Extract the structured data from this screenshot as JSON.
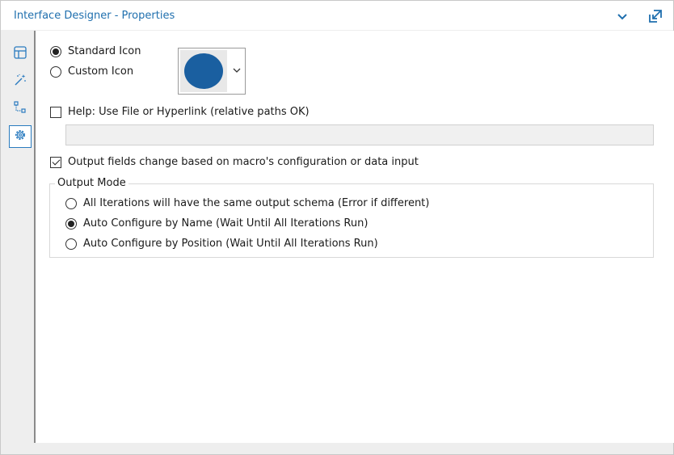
{
  "window": {
    "title": "Interface Designer - Properties"
  },
  "colors": {
    "title": "#1f6fae",
    "accent": "#2a7bbf",
    "icon_fill": "#1a5fa0"
  },
  "sidebar": {
    "tabs": [
      {
        "name": "layout-icon",
        "active": false
      },
      {
        "name": "magic-wand-icon",
        "active": false
      },
      {
        "name": "tree-icon",
        "active": false
      },
      {
        "name": "gear-icon",
        "active": true
      }
    ]
  },
  "icon_options": {
    "standard_label": "Standard Icon",
    "custom_label": "Custom Icon",
    "selected": "standard"
  },
  "help": {
    "label": "Help: Use File or Hyperlink (relative paths OK)",
    "checked": false,
    "value": ""
  },
  "output_fields": {
    "label": "Output fields change based on macro's configuration or data input",
    "checked": true
  },
  "output_mode": {
    "legend": "Output Mode",
    "options": [
      {
        "label": "All Iterations will have the same output schema (Error if different)",
        "selected": false
      },
      {
        "label": "Auto Configure by Name (Wait Until All Iterations Run)",
        "selected": true
      },
      {
        "label": "Auto Configure by Position (Wait Until All Iterations Run)",
        "selected": false
      }
    ]
  }
}
